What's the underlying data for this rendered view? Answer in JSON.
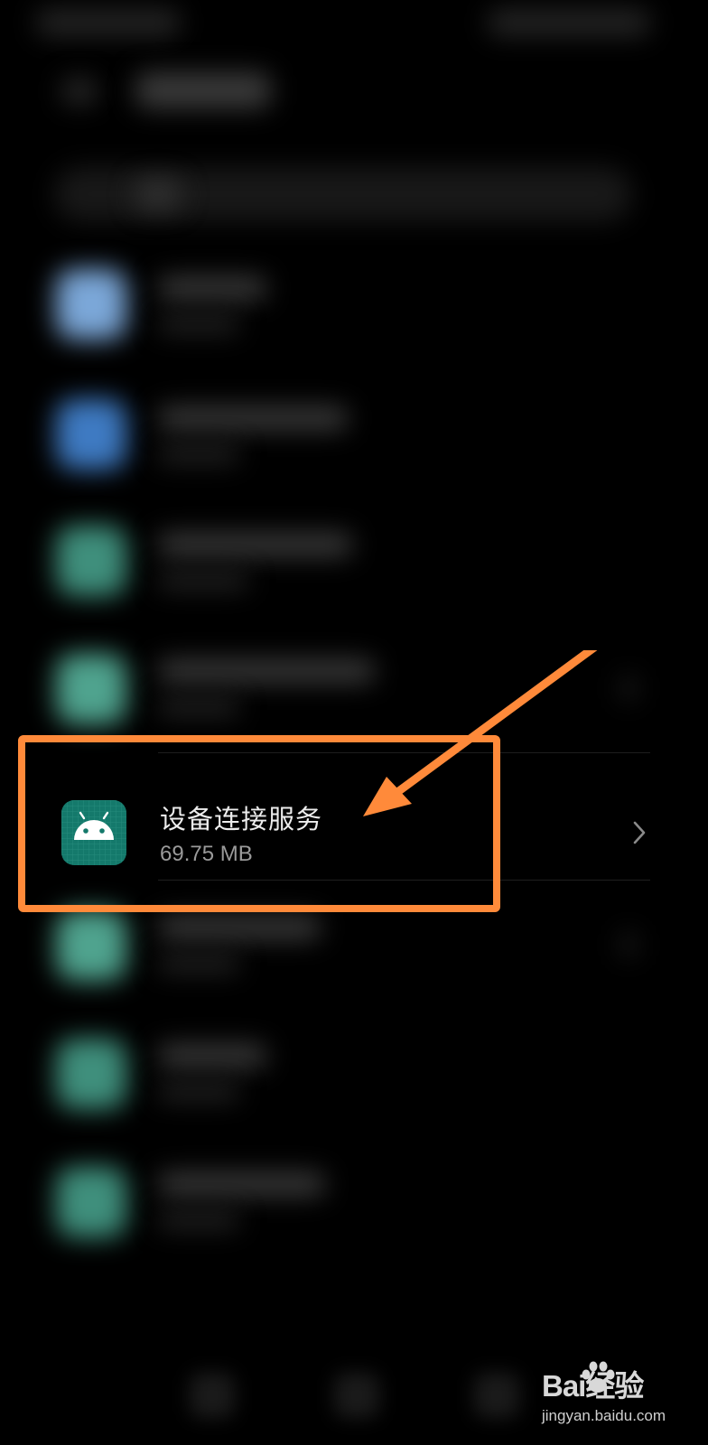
{
  "app_list": {
    "highlighted_item": {
      "name": "设备连接服务",
      "size": "69.75 MB",
      "icon": "android-icon"
    }
  },
  "annotation": {
    "box_color": "#ff8a3a",
    "arrow_color": "#ff8a3a"
  },
  "watermark": {
    "brand": "Bai经验",
    "url": "jingyan.baidu.com"
  },
  "colors": {
    "background": "#000000",
    "app_icon_bg": "#14796b",
    "primary_text": "#ececec",
    "secondary_text": "#9a9a9a"
  }
}
